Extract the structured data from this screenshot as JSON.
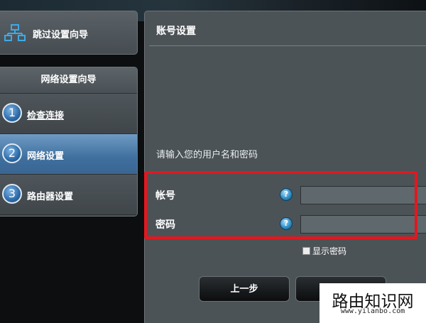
{
  "sidebar": {
    "skip_wizard": {
      "label": "跳过设置向导",
      "icon": "network-icon"
    },
    "wizard": {
      "title": "网络设置向导",
      "steps": [
        {
          "number": "1",
          "label": "检查连接",
          "state": "visited"
        },
        {
          "number": "2",
          "label": "网络设置",
          "state": "active"
        },
        {
          "number": "3",
          "label": "路由器设置",
          "state": "pending"
        }
      ]
    }
  },
  "main": {
    "title": "账号设置",
    "instruction": "请输入您的用户名和密码",
    "fields": {
      "username": {
        "label": "帐号",
        "value": "",
        "help_icon": "help-icon"
      },
      "password": {
        "label": "密码",
        "value": "",
        "help_icon": "help-icon"
      }
    },
    "show_password": {
      "label": "显示密码",
      "checked": false
    },
    "buttons": {
      "back": "上一步",
      "next": ""
    }
  },
  "watermark": {
    "text": "路由知识网",
    "url": "www.yilanbo.com"
  },
  "colors": {
    "panel_bg": "#4c5357",
    "active_step": "#3f6f9e",
    "highlight": "#e3171f",
    "help_icon": "#2a86c0"
  }
}
